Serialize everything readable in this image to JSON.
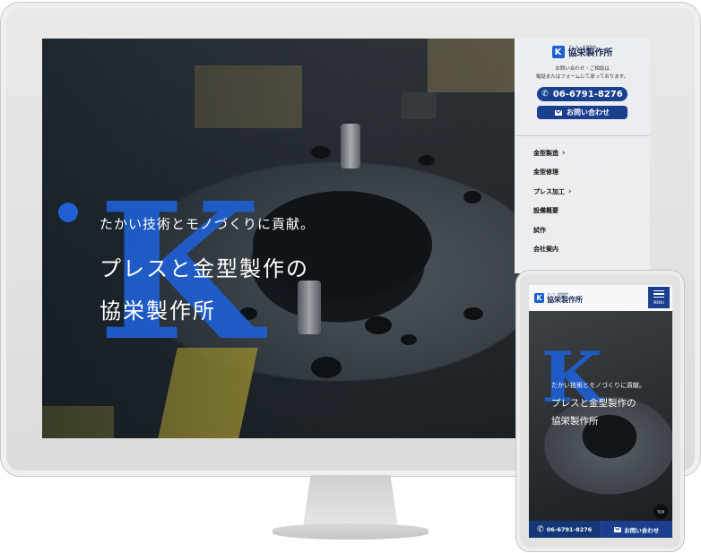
{
  "brand": {
    "logo_letter": "K",
    "sub": "プレス・金型製作",
    "name": "協栄製作所"
  },
  "hero": {
    "tagline": "たかい技術とモノづくりに貢献。",
    "title_line1": "プレスと金型製作の",
    "title_line2": "協栄製作所",
    "watermark_letter": "K"
  },
  "sidebar": {
    "note_line1": "お問い合わせ・ご相談は",
    "note_line2": "電話またはフォームにて承っております。",
    "phone": "06-6791-8276",
    "contact_label": "お問い合わせ",
    "nav": [
      {
        "label": "金型製造",
        "chevron": true
      },
      {
        "label": "金型修理",
        "chevron": false
      },
      {
        "label": "プレス加工",
        "chevron": true
      },
      {
        "label": "設備概要",
        "chevron": false
      },
      {
        "label": "試作",
        "chevron": false
      },
      {
        "label": "会社案内",
        "chevron": false
      }
    ]
  },
  "mobile": {
    "menu_label": "MENU",
    "top_label": "TOP",
    "phone": "06-6791-8276",
    "contact_label": "お問い合わせ"
  },
  "colors": {
    "accent": "#1f5fd1",
    "navy": "#1a3f8f"
  }
}
